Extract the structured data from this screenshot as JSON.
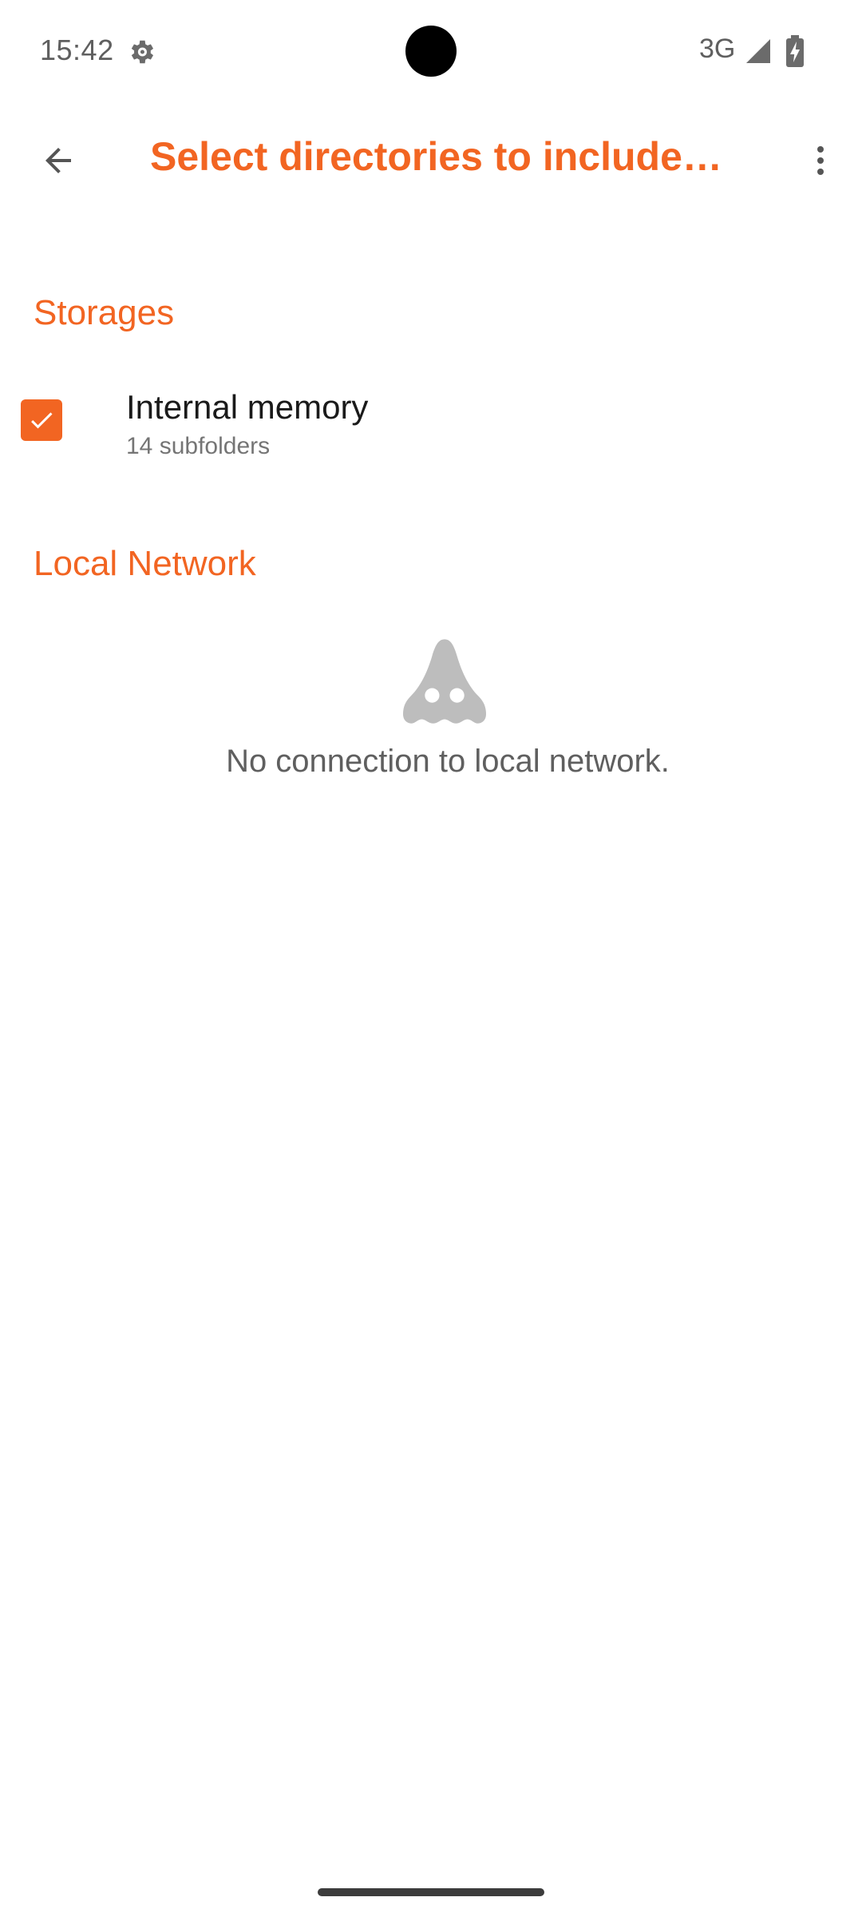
{
  "status_bar": {
    "time": "15:42",
    "network": "3G",
    "icons": [
      "gear-icon",
      "signal-icon",
      "battery-charging-icon"
    ]
  },
  "toolbar": {
    "title": "Select directories to include…",
    "back_icon": "arrow-back-icon",
    "menu_icon": "more-vert-icon"
  },
  "sections": {
    "storages": {
      "title": "Storages",
      "items": [
        {
          "name": "Internal memory",
          "subtitle": "14 subfolders",
          "checked": true
        }
      ]
    },
    "local_network": {
      "title": "Local Network",
      "empty_icon": "ghost-icon",
      "empty_text": "No connection to local network."
    }
  },
  "colors": {
    "accent": "#f26522",
    "text_primary": "#1a1a1a",
    "text_secondary": "#757575",
    "icon_gray": "#5f5f5f",
    "empty_icon_gray": "#bdbdbd"
  }
}
